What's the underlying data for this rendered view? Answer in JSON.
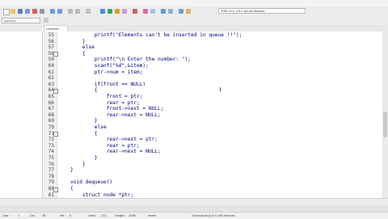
{
  "menu": [
    "File",
    "Edit",
    "Search",
    "View",
    "Project",
    "Execute",
    "Tools",
    "AStyle",
    "Window",
    "Help"
  ],
  "toolbar": {
    "compiler": "TDM-GCC 4.9.2 64-bit Release",
    "scope": "(globals)"
  },
  "left_panel": {
    "tabs": [
      "Project",
      "Classes",
      "Debug"
    ]
  },
  "editor": {
    "file_tab": "Untitled1",
    "lines": [
      {
        "n": "55",
        "code": "        printf(\"Elements can't be inserted in queue !!\");",
        "fold": ""
      },
      {
        "n": "56",
        "code": "    }",
        "fold": ""
      },
      {
        "n": "57",
        "code": "    else",
        "fold": ""
      },
      {
        "n": "58",
        "code": "    {",
        "fold": "-"
      },
      {
        "n": "59",
        "code": "        printf(\"\\n Enter the number: \");",
        "fold": ""
      },
      {
        "n": "60",
        "code": "        scanf(\"%d\",&item);",
        "fold": ""
      },
      {
        "n": "61",
        "code": "        ptr->num = item;",
        "fold": ""
      },
      {
        "n": "62",
        "code": "",
        "fold": ""
      },
      {
        "n": "63",
        "code": "        if(front == NULL)",
        "fold": ""
      },
      {
        "n": "64",
        "code": "        {",
        "fold": "-"
      },
      {
        "n": "65",
        "code": "            front = ptr;",
        "fold": ""
      },
      {
        "n": "66",
        "code": "            rear = ptr;",
        "fold": ""
      },
      {
        "n": "67",
        "code": "            front->next = NULL;",
        "fold": ""
      },
      {
        "n": "68",
        "code": "            rear->next = NULL;",
        "fold": ""
      },
      {
        "n": "69",
        "code": "        }",
        "fold": ""
      },
      {
        "n": "70",
        "code": "        else",
        "fold": ""
      },
      {
        "n": "71",
        "code": "        {",
        "fold": "-"
      },
      {
        "n": "72",
        "code": "            rear->next = ptr;",
        "fold": ""
      },
      {
        "n": "73",
        "code": "            rear = ptr;",
        "fold": ""
      },
      {
        "n": "74",
        "code": "            rear->next = NULL;",
        "fold": ""
      },
      {
        "n": "75",
        "code": "        }",
        "fold": ""
      },
      {
        "n": "76",
        "code": "    }",
        "fold": ""
      },
      {
        "n": "77",
        "code": "}",
        "fold": ""
      },
      {
        "n": "78",
        "code": "",
        "fold": ""
      },
      {
        "n": "79",
        "code": "void dequeue()",
        "fold": ""
      },
      {
        "n": "80",
        "code": "{",
        "fold": "-"
      },
      {
        "n": "81",
        "code": "    struct node *ptr;",
        "fold": ""
      }
    ]
  },
  "bottom_tabs": [
    "Compiler",
    "Resources",
    "Compile Log",
    "Debug",
    "Find Results"
  ],
  "status": {
    "line": "Line:",
    "line_val": "1",
    "col": "Col:",
    "col_val": "16",
    "sel": "Sel:",
    "sel_val": "0",
    "lines": "Lines:",
    "lines_val": "172",
    "length": "Length:",
    "length_val": "3196",
    "mode": "Insert",
    "message": "Done parsing in 0.156 seconds"
  },
  "colors": {
    "code": "#000080",
    "gutter": "#f0f0f0",
    "bg": "#ffffff"
  }
}
